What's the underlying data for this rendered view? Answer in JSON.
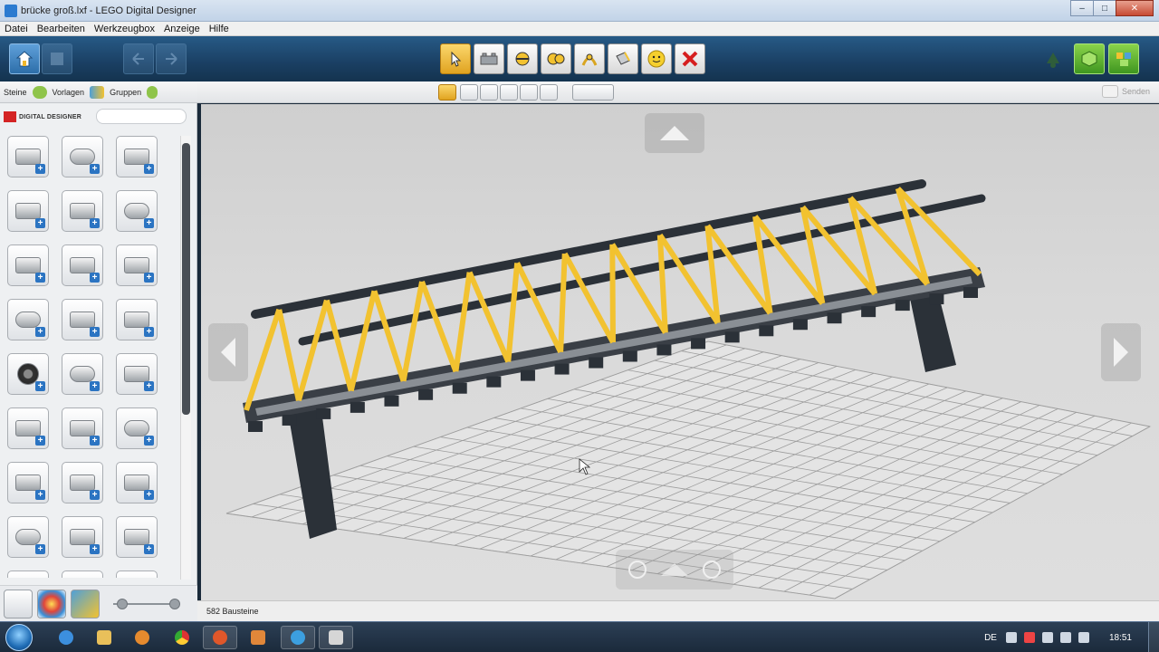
{
  "window": {
    "title": "brücke groß.lxf - LEGO Digital Designer",
    "minimize": "–",
    "maximize": "□",
    "close": "✕"
  },
  "menu": [
    "Datei",
    "Bearbeiten",
    "Werkzeugbox",
    "Anzeige",
    "Hilfe"
  ],
  "toolbar": {
    "home": "home-icon",
    "undo": "undo-arrow-icon",
    "redo": "redo-arrow-icon",
    "tools": [
      {
        "name": "select-tool",
        "icon": "cursor-arrow-icon",
        "active": true
      },
      {
        "name": "clone-tool",
        "icon": "brick-clone-icon",
        "active": false
      },
      {
        "name": "hinge-tool",
        "icon": "hinge-icon",
        "active": false
      },
      {
        "name": "hinge-align-tool",
        "icon": "hinge-align-icon",
        "active": false
      },
      {
        "name": "flex-tool",
        "icon": "flex-icon",
        "active": false
      },
      {
        "name": "paint-tool",
        "icon": "paint-bucket-icon",
        "active": false
      },
      {
        "name": "hide-tool",
        "icon": "minifig-head-icon",
        "active": false
      },
      {
        "name": "delete-tool",
        "icon": "red-x-icon",
        "active": false
      }
    ],
    "modes": [
      "build-mode-icon",
      "view-mode-icon",
      "building-guide-icon"
    ]
  },
  "panel": {
    "tabs": [
      {
        "label": "Steine",
        "color": "#8fc44a"
      },
      {
        "label": "Vorlagen",
        "color": "#4fa0d8"
      },
      {
        "label": "Gruppen",
        "color": "#8fc44a"
      }
    ],
    "brand": "DIGITAL DESIGNER",
    "search_value": "",
    "zoom_level": 0.15
  },
  "subtoolbar": {
    "send": "Senden"
  },
  "status": {
    "count": "582 Bausteine"
  },
  "taskbar": {
    "lang": "DE",
    "time": "18:51"
  },
  "colors": {
    "toolbar": "#1a3f63",
    "active_tool": "#f0b82c",
    "truss": "#f2c230",
    "beam": "#2b3138",
    "grid_bg": "#e4e4e4"
  }
}
